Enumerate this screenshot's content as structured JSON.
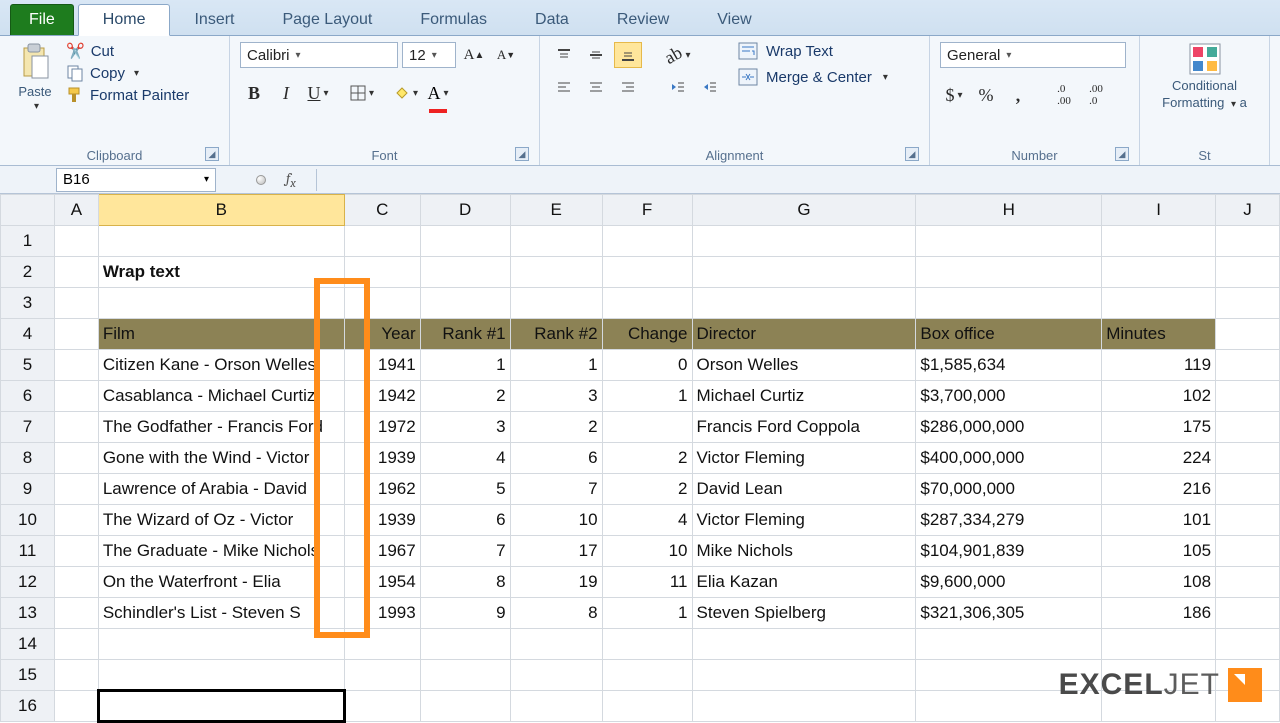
{
  "tabs": {
    "file": "File",
    "home": "Home",
    "insert": "Insert",
    "page_layout": "Page Layout",
    "formulas": "Formulas",
    "data": "Data",
    "review": "Review",
    "view": "View"
  },
  "ribbon": {
    "clipboard": {
      "paste": "Paste",
      "cut": "Cut",
      "copy": "Copy",
      "format_painter": "Format Painter",
      "label": "Clipboard"
    },
    "font": {
      "name": "Calibri",
      "size": "12",
      "label": "Font"
    },
    "alignment": {
      "wrap": "Wrap Text",
      "merge": "Merge & Center",
      "label": "Alignment"
    },
    "number": {
      "format": "General",
      "label": "Number"
    },
    "styles": {
      "conditional": "Conditional",
      "formatting": "Formatting",
      "label": "St"
    }
  },
  "namebox": "B16",
  "title": "Wrap text",
  "columns": [
    "A",
    "B",
    "C",
    "D",
    "E",
    "F",
    "G",
    "H",
    "I",
    "J"
  ],
  "headers": {
    "film": "Film",
    "year": "Year",
    "rank1": "Rank #1",
    "rank2": "Rank #2",
    "change": "Change",
    "director": "Director",
    "box": "Box office",
    "minutes": "Minutes"
  },
  "rows": [
    {
      "film": "Citizen Kane - Orson Welles",
      "year": "1941",
      "r1": "1",
      "r2": "1",
      "chg": "0",
      "dir": "Orson Welles",
      "box": "1,585,634",
      "min": "119"
    },
    {
      "film": "Casablanca - Michael Curtiz",
      "year": "1942",
      "r1": "2",
      "r2": "3",
      "chg": "1",
      "dir": "Michael Curtiz",
      "box": "3,700,000",
      "min": "102"
    },
    {
      "film": "The Godfather - Francis Ford",
      "year": "1972",
      "r1": "3",
      "r2": "2",
      "chg": "",
      "dir": "Francis Ford Coppola",
      "box": "286,000,000",
      "min": "175"
    },
    {
      "film": "Gone with the Wind - Victor",
      "year": "1939",
      "r1": "4",
      "r2": "6",
      "chg": "2",
      "dir": "Victor Fleming",
      "box": "400,000,000",
      "min": "224"
    },
    {
      "film": "Lawrence of Arabia - David",
      "year": "1962",
      "r1": "5",
      "r2": "7",
      "chg": "2",
      "dir": "David Lean",
      "box": "70,000,000",
      "min": "216"
    },
    {
      "film": "The Wizard of Oz - Victor",
      "year": "1939",
      "r1": "6",
      "r2": "10",
      "chg": "4",
      "dir": "Victor Fleming",
      "box": "287,334,279",
      "min": "101"
    },
    {
      "film": "The Graduate - Mike Nichols",
      "year": "1967",
      "r1": "7",
      "r2": "17",
      "chg": "10",
      "dir": "Mike Nichols",
      "box": "104,901,839",
      "min": "105"
    },
    {
      "film": "On the Waterfront - Elia",
      "year": "1954",
      "r1": "8",
      "r2": "19",
      "chg": "11",
      "dir": "Elia Kazan",
      "box": "9,600,000",
      "min": "108"
    },
    {
      "film": "Schindler's List - Steven S",
      "year": "1993",
      "r1": "9",
      "r2": "8",
      "chg": "1",
      "dir": "Steven Spielberg",
      "box": "321,306,305",
      "min": "186"
    }
  ],
  "logo": {
    "a": "EXCEL",
    "b": "JET"
  }
}
